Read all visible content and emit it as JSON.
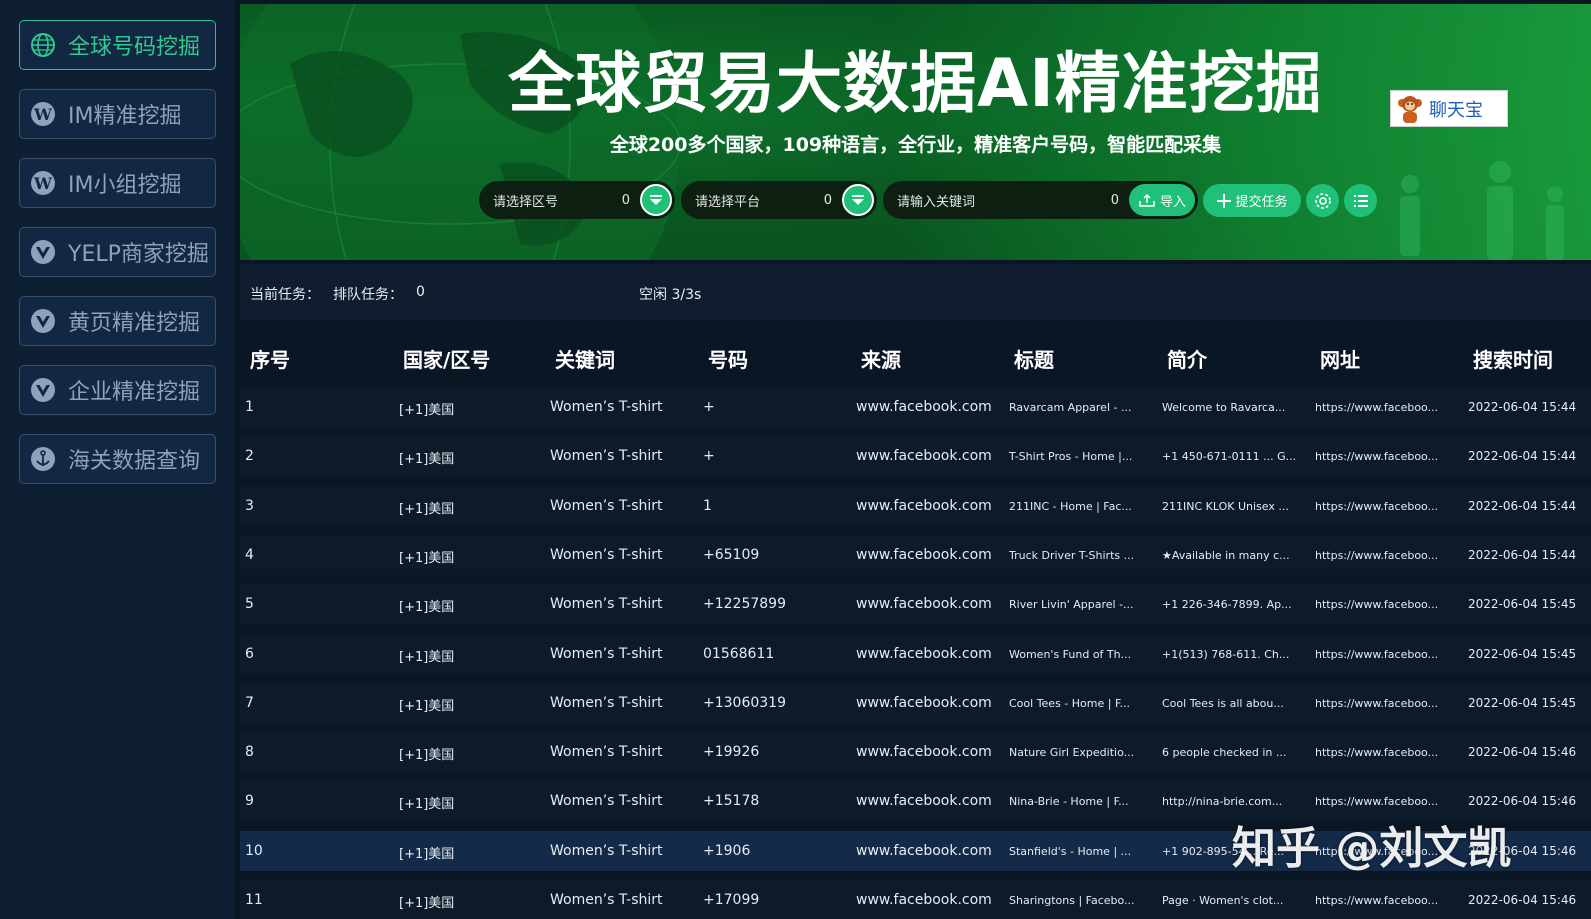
{
  "sidebar": {
    "items": [
      {
        "label": "全球号码挖掘",
        "icon": "globe-icon",
        "active": true
      },
      {
        "label": "IM精准挖掘",
        "icon": "wordpress-icon",
        "active": false
      },
      {
        "label": "IM小组挖掘",
        "icon": "wordpress-icon",
        "active": false
      },
      {
        "label": "YELP商家挖掘",
        "icon": "vuejs-icon",
        "active": false
      },
      {
        "label": "黄页精准挖掘",
        "icon": "vuejs-icon",
        "active": false
      },
      {
        "label": "企业精准挖掘",
        "icon": "vuejs-icon",
        "active": false
      },
      {
        "label": "海关数据查询",
        "icon": "anchor-icon",
        "active": false
      }
    ]
  },
  "banner": {
    "title": "全球贸易大数据AI精准挖掘",
    "subtitle": "全球200多个国家，109种语言，全行业，精准客户号码，智能匹配采集",
    "chat_button": "聊天宝",
    "region_placeholder": "请选择区号",
    "region_count": "0",
    "platform_placeholder": "请选择平台",
    "platform_count": "0",
    "keyword_placeholder": "请输入关键词",
    "keyword_count": "0",
    "import_label": "导入",
    "submit_label": "提交任务"
  },
  "status": {
    "current_task_label": "当前任务：",
    "queue_label": "排队任务：",
    "queue_value": "0",
    "idle_text": "空闲 3/3s"
  },
  "table": {
    "headers": [
      "序号",
      "国家/区号",
      "关键词",
      "号码",
      "来源",
      "标题",
      "简介",
      "网址",
      "搜索时间"
    ],
    "rows": [
      {
        "num": "1",
        "country": "[+1]美国",
        "keyword": "Women’s T-shirt",
        "phone": "+",
        "source": "www.facebook.com",
        "title": "Ravarcam Apparel - ...",
        "intro": "Welcome to Ravarca...",
        "url": "https://www.faceboo...",
        "time": "2022-06-04 15:44"
      },
      {
        "num": "2",
        "country": "[+1]美国",
        "keyword": "Women’s T-shirt",
        "phone": "+",
        "source": "www.facebook.com",
        "title": "T-Shirt Pros - Home |...",
        "intro": "+1 450-671-0111 ... G...",
        "url": "https://www.faceboo...",
        "time": "2022-06-04 15:44"
      },
      {
        "num": "3",
        "country": "[+1]美国",
        "keyword": "Women’s T-shirt",
        "phone": "1",
        "source": "www.facebook.com",
        "title": "211INC - Home | Fac...",
        "intro": "211INC KLOK Unisex ...",
        "url": "https://www.faceboo...",
        "time": "2022-06-04 15:44"
      },
      {
        "num": "4",
        "country": "[+1]美国",
        "keyword": "Women’s T-shirt",
        "phone": "+65109",
        "source": "www.facebook.com",
        "title": "Truck Driver T-Shirts ...",
        "intro": "★Available in many c...",
        "url": "https://www.faceboo...",
        "time": "2022-06-04 15:44"
      },
      {
        "num": "5",
        "country": "[+1]美国",
        "keyword": "Women’s T-shirt",
        "phone": "+12257899",
        "source": "www.facebook.com",
        "title": "River Livin' Apparel -...",
        "intro": "+1 226-346-7899. Ap...",
        "url": "https://www.faceboo...",
        "time": "2022-06-04 15:45"
      },
      {
        "num": "6",
        "country": "[+1]美国",
        "keyword": "Women’s T-shirt",
        "phone": "01568611",
        "source": "www.facebook.com",
        "title": "Women's Fund of Th...",
        "intro": "+1(513) 768-611. Ch...",
        "url": "https://www.faceboo...",
        "time": "2022-06-04 15:45"
      },
      {
        "num": "7",
        "country": "[+1]美国",
        "keyword": "Women’s T-shirt",
        "phone": "+13060319",
        "source": "www.facebook.com",
        "title": "Cool Tees - Home | F...",
        "intro": "Cool Tees is all abou...",
        "url": "https://www.faceboo...",
        "time": "2022-06-04 15:45"
      },
      {
        "num": "8",
        "country": "[+1]美国",
        "keyword": "Women’s T-shirt",
        "phone": "+19926",
        "source": "www.facebook.com",
        "title": "Nature Girl Expeditio...",
        "intro": "6 people checked in ...",
        "url": "https://www.faceboo...",
        "time": "2022-06-04 15:46"
      },
      {
        "num": "9",
        "country": "[+1]美国",
        "keyword": "Women’s T-shirt",
        "phone": "+15178",
        "source": "www.facebook.com",
        "title": "Nina-Brie - Home | F...",
        "intro": "http://nina-brie.com...",
        "url": "https://www.faceboo...",
        "time": "2022-06-04 15:46"
      },
      {
        "num": "10",
        "country": "[+1]美国",
        "keyword": "Women’s T-shirt",
        "phone": "+1906",
        "source": "www.facebook.com",
        "title": "Stanfield's - Home | ...",
        "intro": "+1 902-895-54... Re...",
        "url": "https://www.faceboo...",
        "time": "2022-06-04 15:46",
        "highlight": true
      },
      {
        "num": "11",
        "country": "[+1]美国",
        "keyword": "Women’s T-shirt",
        "phone": "+17099",
        "source": "www.facebook.com",
        "title": "Sharingtons | Facebo...",
        "intro": "Page · Women's clot...",
        "url": "https://www.faceboo...",
        "time": "2022-06-04 15:46"
      }
    ]
  },
  "watermark": "知乎 @刘文凯",
  "colors": {
    "accent": "#20c078",
    "sidebar_bg": "#0e1e33",
    "banner_green": "#0a5a22"
  }
}
